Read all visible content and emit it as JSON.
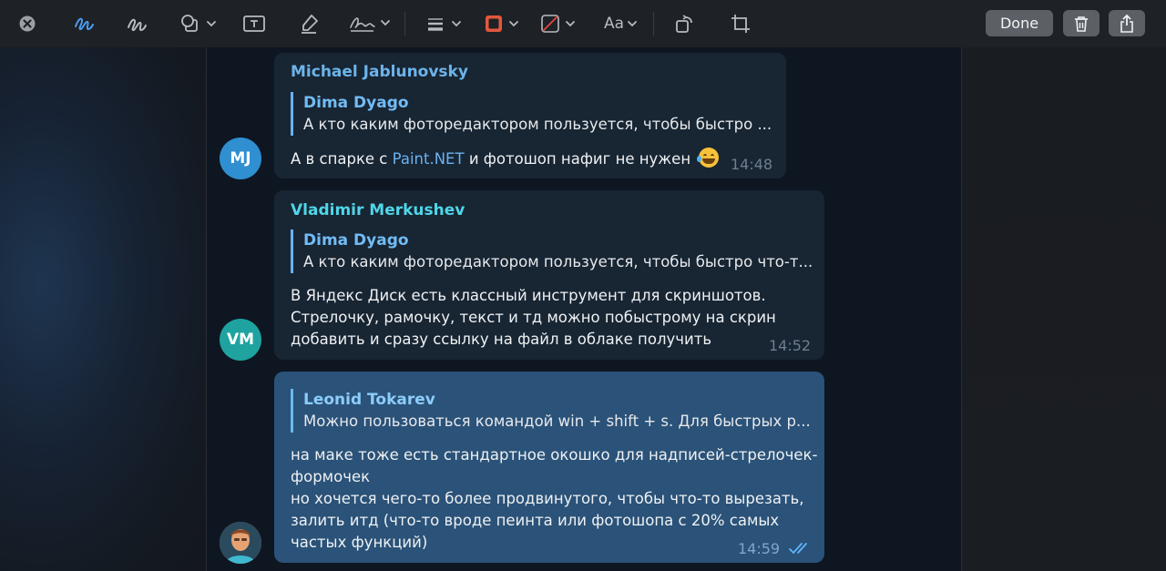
{
  "toolbar": {
    "aa_label": "Aa",
    "done_label": "Done",
    "accent_color": "#4a9df0",
    "border_color": "#e2573c"
  },
  "messages": [
    {
      "sender": "Michael Jablunovsky",
      "avatar_initials": "MJ",
      "avatar_color": "#2f8fd1",
      "reply_to": {
        "name": "Dima Dyago",
        "text": "А кто каким фоторедактором пользуется, чтобы быстро ..."
      },
      "text_before": "А в спарке с",
      "link": "Paint.NET",
      "text_after": "и фотошоп нафиг не нужен",
      "emoji": "face-with-tears-of-joy",
      "time": "14:48"
    },
    {
      "sender": "Vladimir Merkushev",
      "avatar_initials": "VM",
      "avatar_color": "#1fa3a0",
      "reply_to": {
        "name": "Dima Dyago",
        "text": "А кто каким фоторедактором пользуется, чтобы быстро что-т..."
      },
      "lines": [
        "В Яндекс Диск есть классный инструмент для скриншотов.",
        "Стрелочку, рамочку, текст и тд можно побыстрому на скрин",
        "добавить и сразу ссылку на файл в облаке получить"
      ],
      "time": "14:52"
    },
    {
      "own": true,
      "reply_to": {
        "name": "Leonid Tokarev",
        "text": "Можно пользоваться командой win + shift + s. Для быстрых р..."
      },
      "lines": [
        "на маке тоже есть стандартное окошко для надписей-стрелочек-",
        "формочек",
        "но хочется чего-то более продвинутого, чтобы что-то вырезать,",
        "залить итд (что-то вроде пеинта или фотошопа с 20% самых",
        "частых функций)"
      ],
      "time": "14:59",
      "status": "read"
    }
  ]
}
